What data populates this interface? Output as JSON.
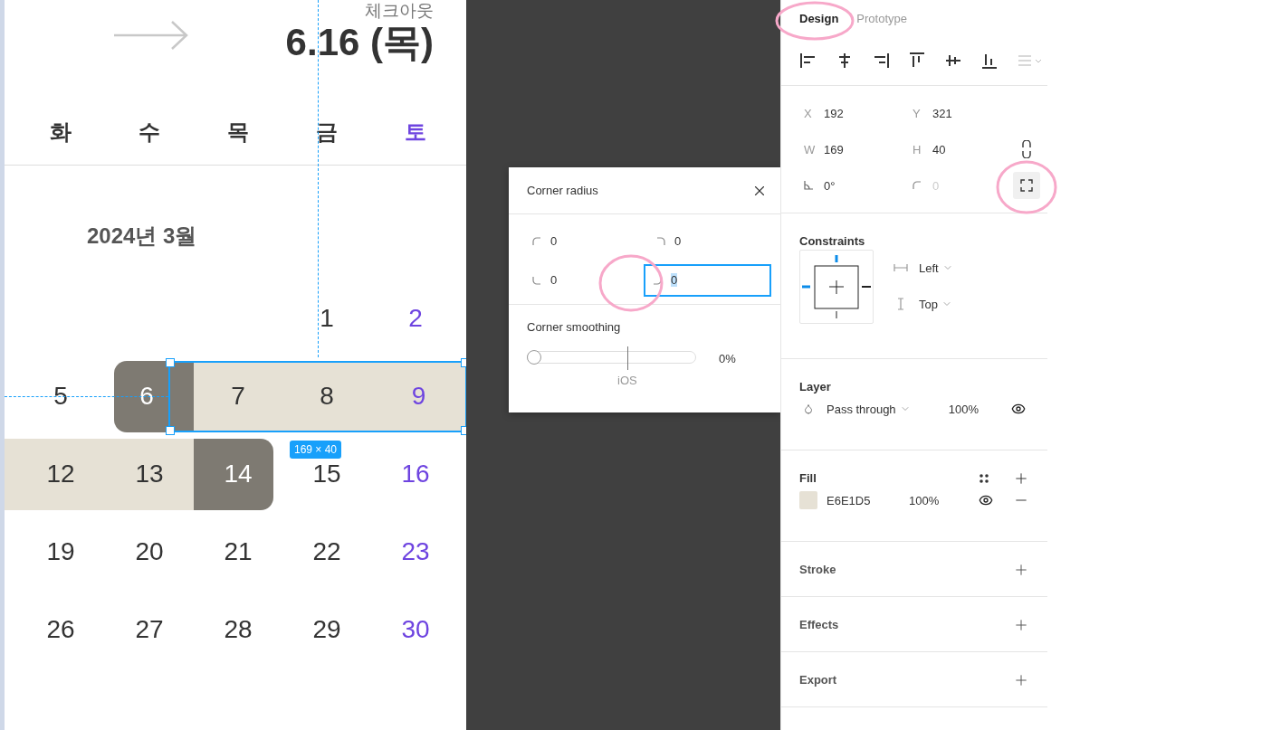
{
  "canvas": {
    "checkout_label": "체크아웃",
    "checkout_date": "6.16 (목)",
    "weekdays": [
      {
        "label": "화",
        "weekend": false
      },
      {
        "label": "수",
        "weekend": false
      },
      {
        "label": "목",
        "weekend": false
      },
      {
        "label": "금",
        "weekend": false
      },
      {
        "label": "토",
        "weekend": true
      }
    ],
    "month": "2024년 3월",
    "weeks": [
      [
        {
          "kind": "blank"
        },
        {
          "kind": "blank"
        },
        {
          "kind": "blank"
        },
        {
          "kind": "day",
          "day": "1",
          "weekend": false,
          "in_range": false,
          "endpoint": false
        },
        {
          "kind": "day",
          "day": "2",
          "weekend": true,
          "in_range": false,
          "endpoint": false
        }
      ],
      [
        {
          "kind": "day",
          "day": "5",
          "weekend": false,
          "in_range": false,
          "endpoint": false
        },
        {
          "kind": "day",
          "day": "6",
          "weekend": false,
          "in_range": true,
          "endpoint": true
        },
        {
          "kind": "day",
          "day": "7",
          "weekend": false,
          "in_range": true,
          "endpoint": false
        },
        {
          "kind": "day",
          "day": "8",
          "weekend": false,
          "in_range": true,
          "endpoint": false
        },
        {
          "kind": "day",
          "day": "9",
          "weekend": true,
          "in_range": true,
          "endpoint": false
        }
      ],
      [
        {
          "kind": "day",
          "day": "12",
          "weekend": false,
          "in_range": true,
          "endpoint": false
        },
        {
          "kind": "day",
          "day": "13",
          "weekend": false,
          "in_range": true,
          "endpoint": false
        },
        {
          "kind": "day",
          "day": "14",
          "weekend": false,
          "in_range": true,
          "endpoint": true
        },
        {
          "kind": "day",
          "day": "15",
          "weekend": false,
          "in_range": false,
          "endpoint": false
        },
        {
          "kind": "day",
          "day": "16",
          "weekend": true,
          "in_range": false,
          "endpoint": false
        }
      ],
      [
        {
          "kind": "day",
          "day": "19",
          "weekend": false,
          "in_range": false,
          "endpoint": false
        },
        {
          "kind": "day",
          "day": "20",
          "weekend": false,
          "in_range": false,
          "endpoint": false
        },
        {
          "kind": "day",
          "day": "21",
          "weekend": false,
          "in_range": false,
          "endpoint": false
        },
        {
          "kind": "day",
          "day": "22",
          "weekend": false,
          "in_range": false,
          "endpoint": false
        },
        {
          "kind": "day",
          "day": "23",
          "weekend": true,
          "in_range": false,
          "endpoint": false
        }
      ],
      [
        {
          "kind": "day",
          "day": "26",
          "weekend": false,
          "in_range": false,
          "endpoint": false
        },
        {
          "kind": "day",
          "day": "27",
          "weekend": false,
          "in_range": false,
          "endpoint": false
        },
        {
          "kind": "day",
          "day": "28",
          "weekend": false,
          "in_range": false,
          "endpoint": false
        },
        {
          "kind": "day",
          "day": "29",
          "weekend": false,
          "in_range": false,
          "endpoint": false
        },
        {
          "kind": "day",
          "day": "30",
          "weekend": true,
          "in_range": false,
          "endpoint": false
        }
      ]
    ]
  },
  "selection": {
    "size": "169 × 40"
  },
  "dialog": {
    "title": "Corner radius",
    "corners": [
      {
        "value": "0",
        "focused": false
      },
      {
        "value": "0",
        "focused": false
      },
      {
        "value": "0",
        "focused": false
      },
      {
        "value": "0",
        "focused": true
      }
    ],
    "smoothing": {
      "label": "Corner smoothing",
      "level": 0,
      "reading": "0%",
      "tick_label": "iOS"
    }
  },
  "panel": {
    "tabs": [
      {
        "label": "Design",
        "selected": true
      },
      {
        "label": "Prototype",
        "selected": false
      }
    ],
    "position": [
      {
        "label": "X",
        "value": "192"
      },
      {
        "label": "Y",
        "value": "321"
      },
      {
        "label": "W",
        "value": "169"
      },
      {
        "label": "H",
        "value": "40"
      }
    ],
    "rotation": "0°",
    "radius": {
      "value": "0",
      "disabled": true
    },
    "independent_corners": {
      "active": true
    },
    "constraints": {
      "title": "Constraints",
      "horizontal": "Left",
      "vertical": "Top"
    },
    "layer": {
      "title": "Layer",
      "blend": "Pass through",
      "opacity": "100%"
    },
    "fill": {
      "title": "Fill",
      "items": [
        {
          "color": "#e6e1d5",
          "hex": "E6E1D5",
          "opacity": "100%"
        }
      ]
    },
    "sections": [
      {
        "title": "Stroke"
      },
      {
        "title": "Effects"
      },
      {
        "title": "Export"
      }
    ]
  }
}
